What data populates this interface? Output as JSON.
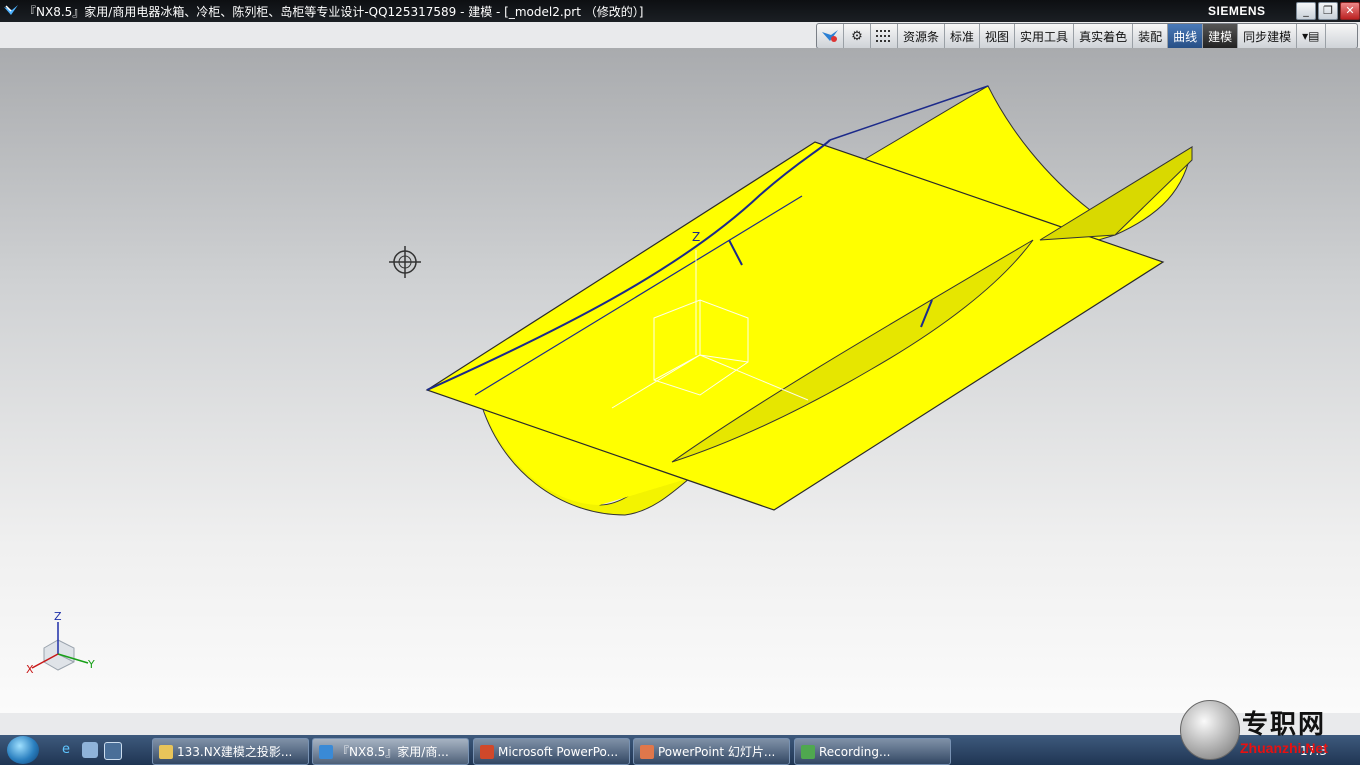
{
  "window": {
    "title": "『NX8.5』家用/商用电器冰箱、冷柜、陈列柜、岛柜等专业设计-QQ125317589 - 建模 - [_model2.prt （修改的）]",
    "brand": "SIEMENS",
    "controls": {
      "minimize": "_",
      "restore": "❐",
      "close": "✕"
    }
  },
  "toolbar": {
    "icons": [
      "nx-logo-icon",
      "gear-icon",
      "grid-icon"
    ],
    "tabs": [
      {
        "label": "资源条"
      },
      {
        "label": "标准"
      },
      {
        "label": "视图"
      },
      {
        "label": "实用工具"
      },
      {
        "label": "真实着色"
      },
      {
        "label": "装配"
      },
      {
        "label": "曲线",
        "state": "active"
      },
      {
        "label": "建模",
        "state": "dark"
      },
      {
        "label": "同步建模"
      }
    ],
    "more": "▾▤"
  },
  "viewport": {
    "surface_color": "#ffff00",
    "edge_color": "#1a237e",
    "triad": {
      "x": "X",
      "y": "Y",
      "z": "Z"
    },
    "wcs_label": "Z"
  },
  "taskbar": {
    "buttons": [
      {
        "label": "133.NX建模之投影..."
      },
      {
        "label": "『NX8.5』家用/商..."
      },
      {
        "label": "Microsoft PowerPo..."
      },
      {
        "label": "PowerPoint 幻灯片..."
      },
      {
        "label": "Recording..."
      }
    ],
    "clock": "17:3"
  },
  "watermark": {
    "text": "专职网",
    "url": "Zhuanzhi.Net"
  }
}
